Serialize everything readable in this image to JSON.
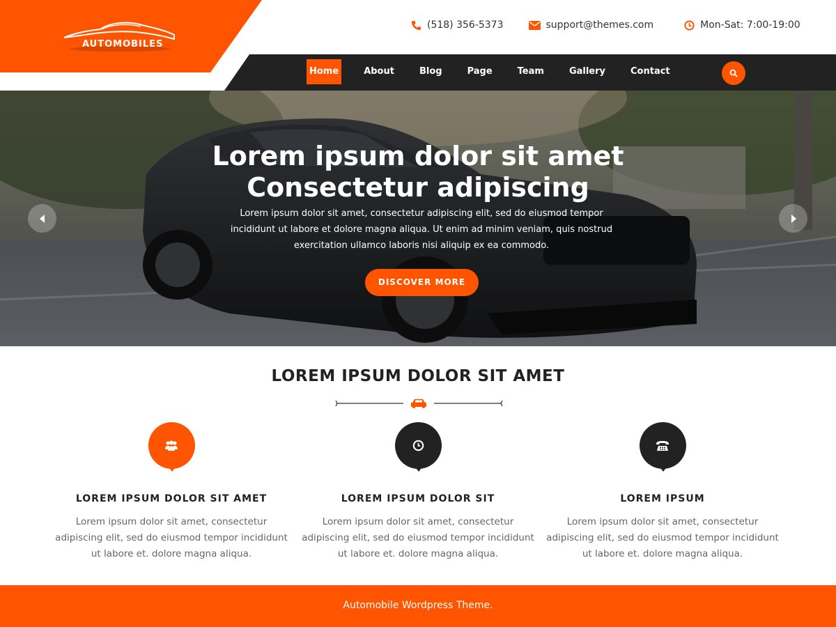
{
  "brand": {
    "logo_text": "AUTOMOBILES",
    "accent": "#ff5400",
    "dark": "#222222"
  },
  "contact": {
    "phone": "(518) 356-5373",
    "email": "support@themes.com",
    "hours": "Mon-Sat: 7:00-19:00",
    "icons": [
      "phone-icon",
      "envelope-icon",
      "clock-icon"
    ]
  },
  "nav": {
    "items": [
      {
        "label": "Home",
        "active": true
      },
      {
        "label": "About"
      },
      {
        "label": "Blog"
      },
      {
        "label": "Page"
      },
      {
        "label": "Team"
      },
      {
        "label": "Gallery"
      },
      {
        "label": "Contact"
      }
    ],
    "search_icon": "search-icon"
  },
  "hero": {
    "title_line1": "Lorem ipsum dolor sit amet",
    "title_line2": "Consectetur adipiscing",
    "text": "Lorem ipsum dolor sit amet, consectetur adipiscing elit, sed do eiusmod tempor incididunt ut labore et dolore magna aliqua. Ut enim ad minim veniam, quis nostrud exercitation ullamco laboris nisi aliquip ex ea commodo.",
    "button": "DISCOVER MORE"
  },
  "features": {
    "title": "LOREM IPSUM DOLOR SIT AMET",
    "items": [
      {
        "icon": "users-icon",
        "color": "#ff5400",
        "heading": "LOREM IPSUM DOLOR SIT AMET",
        "text": "Lorem ipsum dolor sit amet, consectetur adipiscing elit, sed do eiusmod tempor incididunt ut labore et. dolore magna aliqua."
      },
      {
        "icon": "clock-icon",
        "color": "#222222",
        "heading": "LOREM IPSUM DOLOR SIT",
        "text": "Lorem ipsum dolor sit amet, consectetur adipiscing elit, sed do eiusmod tempor incididunt ut labore et. dolore magna aliqua."
      },
      {
        "icon": "phone-icon",
        "color": "#222222",
        "heading": "LOREM IPSUM",
        "text": "Lorem ipsum dolor sit amet, consectetur adipiscing elit, sed do eiusmod tempor incididunt ut labore et. dolore magna aliqua."
      }
    ]
  },
  "footer": {
    "text": "Automobile Wordpress Theme."
  }
}
